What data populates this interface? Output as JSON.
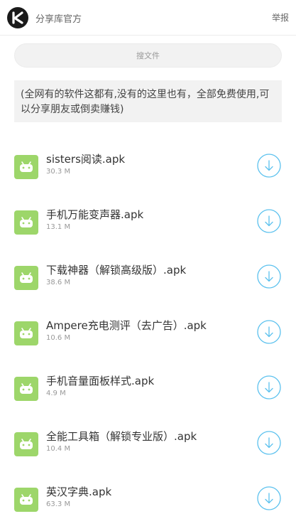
{
  "header": {
    "site_name": "分享库官方",
    "report_label": "举报"
  },
  "search": {
    "placeholder": "搜文件"
  },
  "notice": {
    "text": "(全网有的软件这都有,没有的这里也有，全部免费使用,可以分享朋友或倒卖赚钱)"
  },
  "colors": {
    "apk_icon": "#9dd66a",
    "download_ring": "#5bc1ee",
    "notice_bg": "#f2f2f2"
  },
  "icons": {
    "logo": "k-logo-icon",
    "file": "android-icon",
    "download": "download-icon"
  },
  "files": [
    {
      "name": "sisters阅读.apk",
      "size": "30.3 M"
    },
    {
      "name": "手机万能变声器.apk",
      "size": "13.1 M"
    },
    {
      "name": "下载神器（解锁高级版）.apk",
      "size": "38.6 M"
    },
    {
      "name": "Ampere充电测评（去广告）.apk",
      "size": "10.6 M"
    },
    {
      "name": "手机音量面板样式.apk",
      "size": "4.9 M"
    },
    {
      "name": "全能工具箱（解锁专业版）.apk",
      "size": "10.4 M"
    },
    {
      "name": "英汉字典.apk",
      "size": "63.3 M"
    }
  ]
}
